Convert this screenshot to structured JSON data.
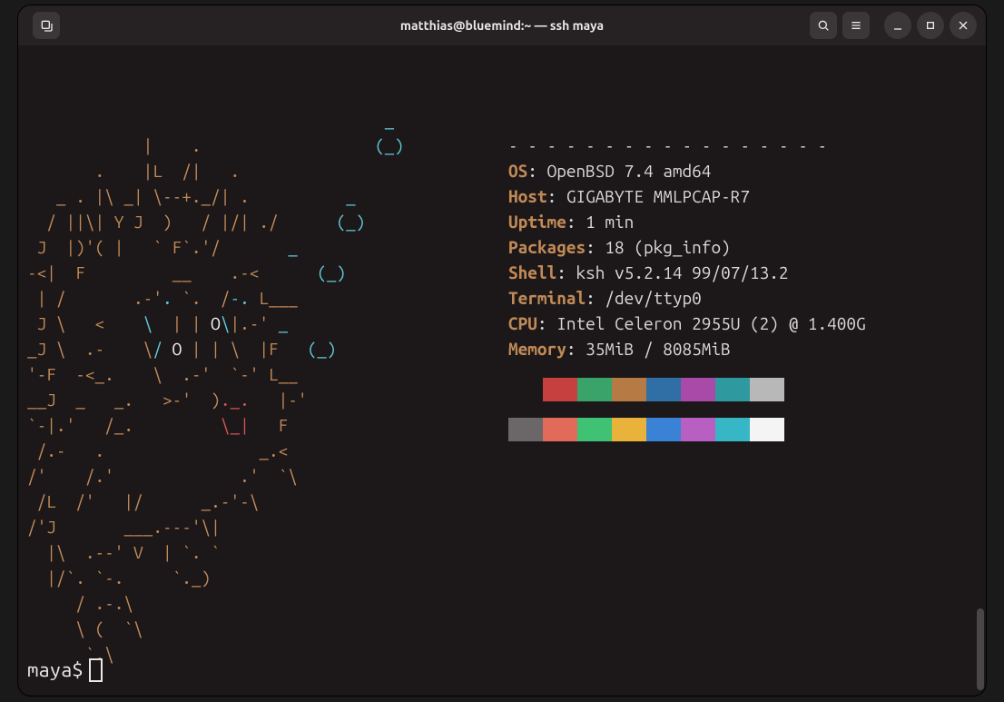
{
  "window": {
    "title": "matthias@bluemind:~ — ssh maya"
  },
  "neofetch": {
    "divider": "- - - - - - - - - - - - - - - - -",
    "fields": {
      "os": {
        "label": "OS",
        "value": "OpenBSD 7.4 amd64"
      },
      "host": {
        "label": "Host",
        "value": "GIGABYTE MMLPCAP-R7"
      },
      "uptime": {
        "label": "Uptime",
        "value": "1 min"
      },
      "packages": {
        "label": "Packages",
        "value": "18 (pkg_info)"
      },
      "shell": {
        "label": "Shell",
        "value": "ksh v5.2.14 99/07/13.2"
      },
      "terminal": {
        "label": "Terminal",
        "value": "/dev/ttyp0"
      },
      "cpu": {
        "label": "CPU",
        "value": "Intel Celeron 2955U (2) @ 1.400G"
      },
      "memory": {
        "label": "Memory",
        "value": "35MiB / 8085MiB"
      }
    },
    "palette_row1": [
      "#1c1718",
      "#c64040",
      "#3aa36a",
      "#b67a44",
      "#2f6fa6",
      "#a94aa9",
      "#2e9aa0",
      "#b8b8b8"
    ],
    "palette_row2": [
      "#6b6668",
      "#e16a5b",
      "#3fc274",
      "#e9b33b",
      "#3a82d6",
      "#b760c1",
      "#37b7c6",
      "#f4f4f4"
    ]
  },
  "ascii": {
    "lines": [
      [
        [
          "cy",
          "                                     _"
        ]
      ],
      [
        [
          "yl",
          "            |    .                  "
        ],
        [
          "cy",
          "(_)"
        ]
      ],
      [
        [
          "yl",
          "       .    |L  /|   ."
        ]
      ],
      [
        [
          "yl",
          "   _ . |\\ _| \\--+._/| .          "
        ],
        [
          "cy",
          "_"
        ]
      ],
      [
        [
          "yl",
          "  / ||\\| Y J  )   / |/| ./      "
        ],
        [
          "cy",
          "(_)"
        ]
      ],
      [
        [
          "yl",
          " J  |)'( |   ` F`.'/       "
        ],
        [
          "cy",
          "_"
        ]
      ],
      [
        [
          "yl",
          "-<|  F         __    .-<      "
        ],
        [
          "cy",
          "(_)"
        ]
      ],
      [
        [
          "yl",
          " | /       .-'"
        ],
        [
          "cy",
          "."
        ],
        [
          "yl",
          " `.  /"
        ],
        [
          "cy",
          "-."
        ],
        [
          "yl",
          " L___"
        ]
      ],
      [
        [
          "yl",
          " J \\   <    "
        ],
        [
          "cy",
          "\\ "
        ],
        [
          "yl",
          " | |"
        ],
        [
          "wh",
          " O"
        ],
        [
          "cy",
          "\\"
        ],
        [
          "yl",
          "|.-' "
        ],
        [
          "cy",
          "_"
        ]
      ],
      [
        [
          "yl",
          "_J \\  .-    \\"
        ],
        [
          "cy",
          "/"
        ],
        [
          "wh",
          " O"
        ],
        [
          "yl",
          " | |"
        ],
        [
          "yl",
          " \\  |"
        ],
        [
          "yl",
          "F   "
        ],
        [
          "cy",
          "(_)"
        ]
      ],
      [
        [
          "yl",
          "'-F  -<_.    \\  .-'  `-' L__"
        ]
      ],
      [
        [
          "yl",
          "__J  _   _.   >-'  )"
        ],
        [
          "rd",
          "._."
        ],
        [
          "yl",
          "   |-'"
        ]
      ],
      [
        [
          "yl",
          "`-|.'   /_.         "
        ],
        [
          "rd",
          "\\_|"
        ],
        [
          "yl",
          "   F"
        ]
      ],
      [
        [
          "yl",
          " /.-   .                _.<"
        ]
      ],
      [
        [
          "yl",
          "/'    /.'             .'  `\\"
        ]
      ],
      [
        [
          "yl",
          " /L  /'   |/      _.-'-\\"
        ]
      ],
      [
        [
          "yl",
          "/'J       ___.---'\\|"
        ]
      ],
      [
        [
          "yl",
          "  |\\  .--' V  | `. `"
        ]
      ],
      [
        [
          "yl",
          "  |/`. `-.     `._)"
        ]
      ],
      [
        [
          "yl",
          "     / .-.\\"
        ]
      ],
      [
        [
          "yl",
          "     \\ (  `\\"
        ]
      ],
      [
        [
          "yl",
          "      `.\\"
        ]
      ]
    ]
  },
  "prompt": "maya$"
}
